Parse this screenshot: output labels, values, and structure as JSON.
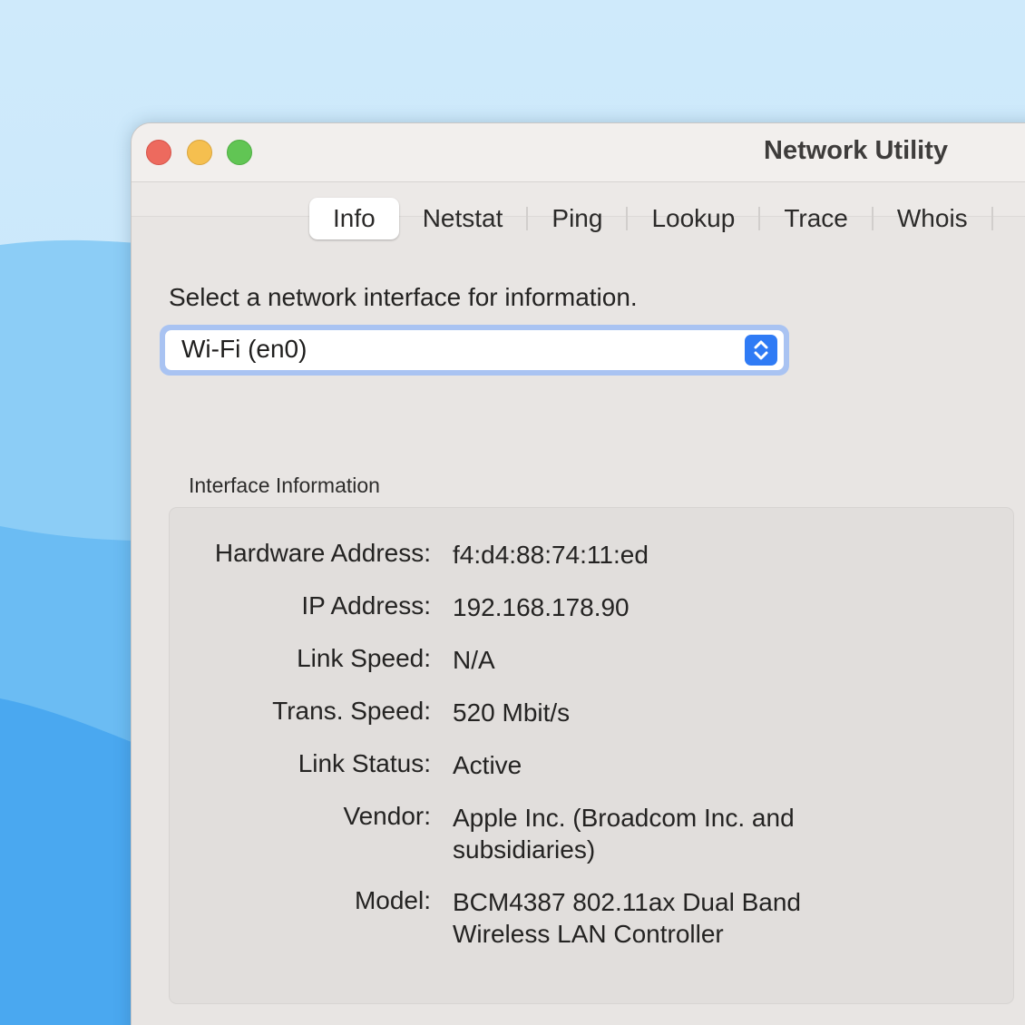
{
  "window": {
    "title": "Network Utility"
  },
  "tabs": [
    {
      "label": "Info",
      "active": true
    },
    {
      "label": "Netstat",
      "active": false
    },
    {
      "label": "Ping",
      "active": false
    },
    {
      "label": "Lookup",
      "active": false
    },
    {
      "label": "Trace",
      "active": false
    },
    {
      "label": "Whois",
      "active": false
    }
  ],
  "info": {
    "prompt": "Select a network interface for information.",
    "selected_interface": "Wi-Fi (en0)",
    "section_label": "Interface Information",
    "rows": [
      {
        "label": "Hardware Address:",
        "value": "f4:d4:88:74:11:ed"
      },
      {
        "label": "IP Address:",
        "value": "192.168.178.90"
      },
      {
        "label": "Link Speed:",
        "value": "N/A"
      },
      {
        "label": "Trans. Speed:",
        "value": "520 Mbit/s"
      },
      {
        "label": "Link Status:",
        "value": "Active"
      },
      {
        "label": "Vendor:",
        "value": "Apple Inc. (Broadcom Inc. and subsidiaries)"
      },
      {
        "label": "Model:",
        "value": "BCM4387 802.11ax Dual Band Wireless LAN Controller"
      }
    ]
  },
  "colors": {
    "accent": "#2f7bf5",
    "close": "#ed6a5e",
    "minimize": "#f5bf4f",
    "zoom": "#61c554"
  },
  "icons": {
    "stepper": "chevron-up-down-icon"
  }
}
